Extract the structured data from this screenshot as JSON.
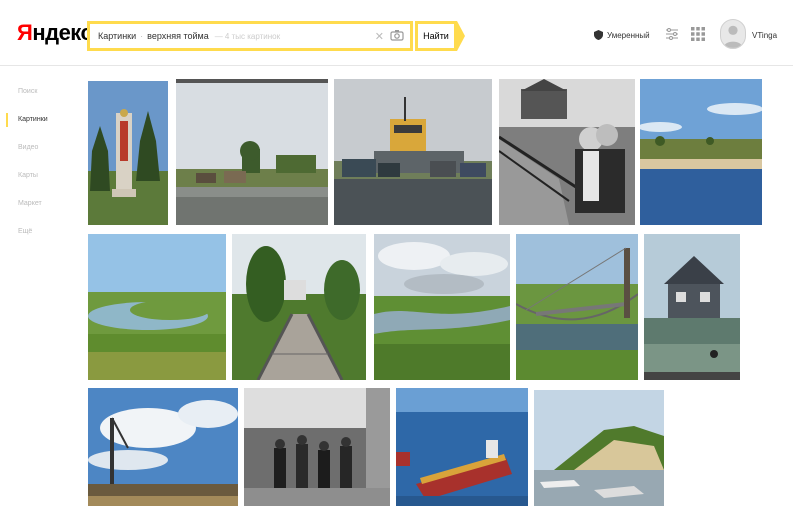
{
  "header": {
    "logo_first": "Я",
    "logo_rest": "ндекс",
    "search": {
      "scope": "Картинки",
      "query": "верхняя тойма",
      "suffix": "— 4 тыс картинок",
      "button_label": "Найти"
    },
    "safe_search_label": "Умеренный",
    "username": "VTinga"
  },
  "sidebar": {
    "items": [
      {
        "label": "Поиск",
        "active": false
      },
      {
        "label": "Картинки",
        "active": true
      },
      {
        "label": "Видео",
        "active": false
      },
      {
        "label": "Карты",
        "active": false
      },
      {
        "label": "Маркет",
        "active": false
      },
      {
        "label": "Ещё",
        "active": false
      }
    ]
  },
  "results": [
    {
      "name": "monument-stele"
    },
    {
      "name": "river-bank-village"
    },
    {
      "name": "ferry-crossing"
    },
    {
      "name": "couple-bridge-bw"
    },
    {
      "name": "riverside-sky"
    },
    {
      "name": "river-meander"
    },
    {
      "name": "suspension-bridge-path"
    },
    {
      "name": "river-valley-clouds"
    },
    {
      "name": "suspension-bridge-river"
    },
    {
      "name": "old-house-painting"
    },
    {
      "name": "crane-clouds"
    },
    {
      "name": "people-bw"
    },
    {
      "name": "barges-river"
    },
    {
      "name": "sandy-bank"
    }
  ],
  "colors": {
    "accent": "#ffdb4d",
    "logo_red": "#ff0000"
  }
}
